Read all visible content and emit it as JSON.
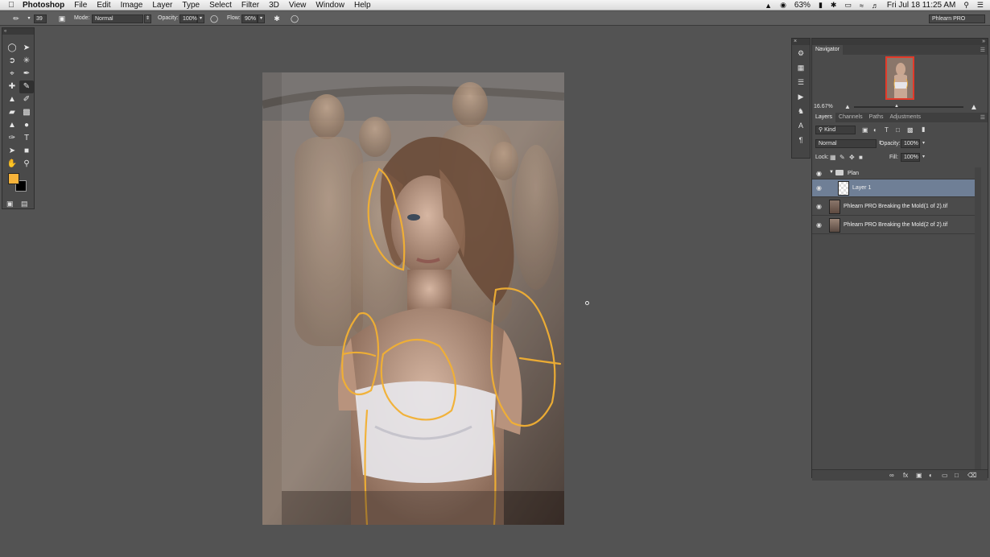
{
  "menubar": {
    "app_name": "Photoshop",
    "items": [
      "File",
      "Edit",
      "Image",
      "Layer",
      "Type",
      "Select",
      "Filter",
      "3D",
      "View",
      "Window",
      "Help"
    ],
    "battery": "63%",
    "datetime": "Fri Jul 18  11:25 AM"
  },
  "options": {
    "brush_size": "39",
    "mode_label": "Mode:",
    "mode_value": "Normal",
    "opacity_label": "Opacity:",
    "opacity_value": "100%",
    "flow_label": "Flow:",
    "flow_value": "90%",
    "workspace": "Phlearn PRO"
  },
  "navigator": {
    "tab": "Navigator",
    "zoom": "16.67%"
  },
  "layers_panel": {
    "tabs": [
      "Layers",
      "Channels",
      "Paths",
      "Adjustments"
    ],
    "filter_kind": "Kind",
    "blend_mode": "Normal",
    "opacity_label": "Opacity:",
    "opacity_value": "100%",
    "lock_label": "Lock:",
    "fill_label": "Fill:",
    "fill_value": "100%",
    "group_name": "Plan",
    "layers": [
      {
        "name": "Layer 1",
        "selected": true
      },
      {
        "name": "Phlearn PRO Breaking the Mold(1 of 2).tif",
        "selected": false
      },
      {
        "name": "Phlearn PRO Breaking the Mold(2 of 2).tif",
        "selected": false
      }
    ]
  },
  "colors": {
    "foreground": "#f6b33a",
    "background": "#000000",
    "sketch": "#f2b033",
    "selection": "#6f7f96"
  },
  "icons": {
    "menubar": [
      "apple-icon",
      "notification-icon",
      "battery-icon",
      "wifi-icon",
      "volume-icon",
      "search-icon",
      "list-icon"
    ],
    "tools": [
      "marquee-icon",
      "move-icon",
      "lasso-icon",
      "magic-wand-icon",
      "crop-icon",
      "eyedropper-icon",
      "healing-icon",
      "brush-icon",
      "stamp-icon",
      "history-brush-icon",
      "eraser-icon",
      "gradient-icon",
      "blur-icon",
      "dodge-icon",
      "pen-icon",
      "type-icon",
      "path-select-icon",
      "shape-icon",
      "hand-icon",
      "zoom-icon"
    ]
  }
}
